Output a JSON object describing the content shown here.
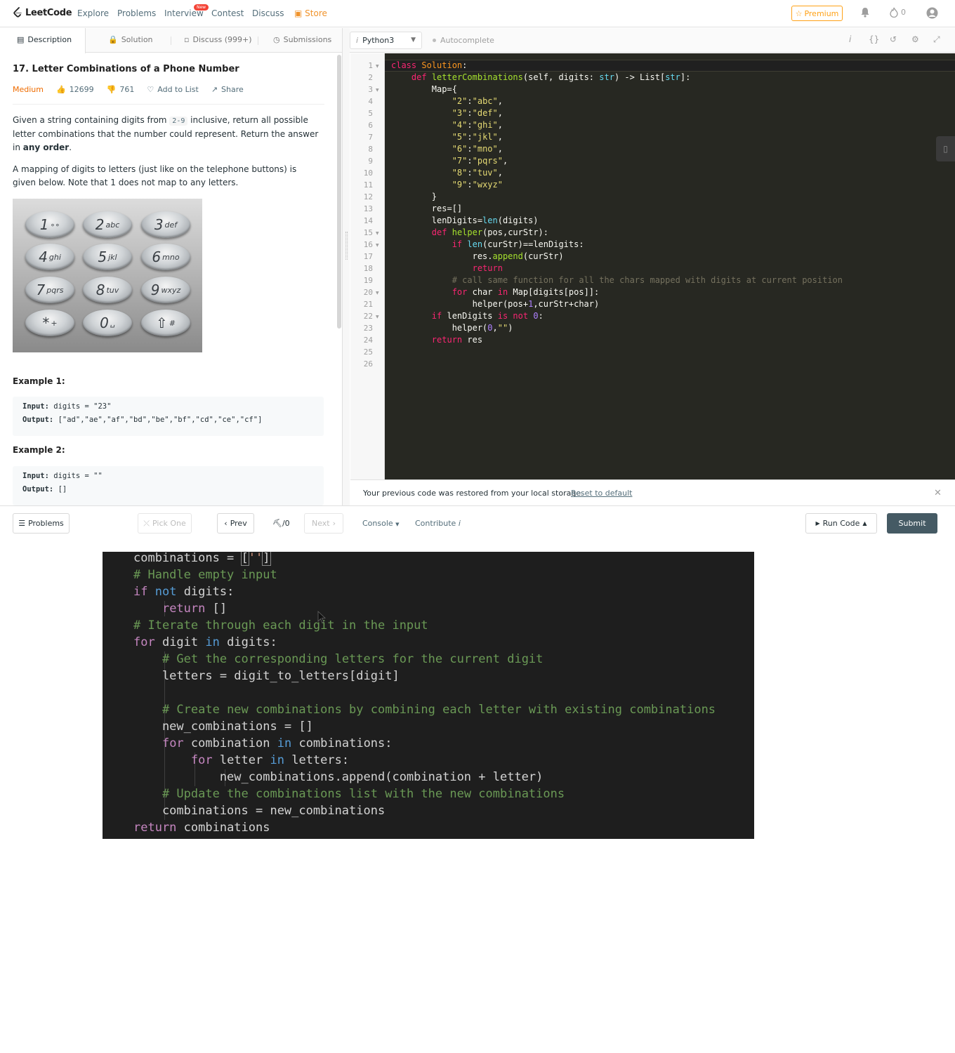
{
  "nav": {
    "logo": "LeetCode",
    "links": [
      "Explore",
      "Problems",
      "Interview",
      "Contest",
      "Discuss",
      "Store"
    ],
    "new_badge": "New",
    "premium": "Premium",
    "streak_count": "0"
  },
  "tabs": [
    "Description",
    "Solution",
    "Discuss (999+)",
    "Submissions"
  ],
  "problem": {
    "title": "17. Letter Combinations of a Phone Number",
    "difficulty": "Medium",
    "likes": "12699",
    "dislikes": "761",
    "add_to_list": "Add to List",
    "share": "Share",
    "p1_a": "Given a string containing digits from ",
    "p1_code": "2-9",
    "p1_b": " inclusive, return all possible letter combinations that the number could represent. Return the answer in ",
    "p1_bold": "any order",
    "p1_c": ".",
    "p2": "A mapping of digits to letters (just like on the telephone buttons) is given below. Note that 1 does not map to any letters.",
    "keys": [
      {
        "n": "1",
        "l": "∘∘"
      },
      {
        "n": "2",
        "l": "abc"
      },
      {
        "n": "3",
        "l": "def"
      },
      {
        "n": "4",
        "l": "ghi"
      },
      {
        "n": "5",
        "l": "jkl"
      },
      {
        "n": "6",
        "l": "mno"
      },
      {
        "n": "7",
        "l": "pqrs"
      },
      {
        "n": "8",
        "l": "tuv"
      },
      {
        "n": "9",
        "l": "wxyz"
      },
      {
        "n": "*",
        "l": "+"
      },
      {
        "n": "0",
        "l": "␣"
      },
      {
        "n": "⇧",
        "l": "#"
      }
    ],
    "examples": [
      {
        "title": "Example 1:",
        "input_label": "Input:",
        "input": "digits = \"23\"",
        "output_label": "Output:",
        "output": "[\"ad\",\"ae\",\"af\",\"bd\",\"be\",\"bf\",\"cd\",\"ce\",\"cf\"]"
      },
      {
        "title": "Example 2:",
        "input_label": "Input:",
        "input": "digits = \"\"",
        "output_label": "Output:",
        "output": "[]"
      }
    ]
  },
  "editor": {
    "language": "Python3",
    "autocomplete": "Autocomplete",
    "line_numbers": [
      "1",
      "2",
      "3",
      "4",
      "5",
      "6",
      "7",
      "8",
      "9",
      "10",
      "11",
      "12",
      "13",
      "14",
      "15",
      "16",
      "17",
      "18",
      "19",
      "20",
      "21",
      "22",
      "23",
      "24",
      "25",
      "26"
    ],
    "restore_message": "Your previous code was restored from your local storage.",
    "reset_link": "Reset to default"
  },
  "bottom": {
    "problems": "Problems",
    "pick_one": "Pick One",
    "prev": "Prev",
    "counter": "/0",
    "next": "Next",
    "console": "Console",
    "contribute": "Contribute",
    "run_code": "Run Code",
    "submit": "Submit"
  },
  "colors": {
    "accent": "#ffa116",
    "medium": "#ef6c00",
    "editor_bg": "#272822",
    "snippet_bg": "#1e1e1e",
    "submit_bg": "#455a64"
  }
}
